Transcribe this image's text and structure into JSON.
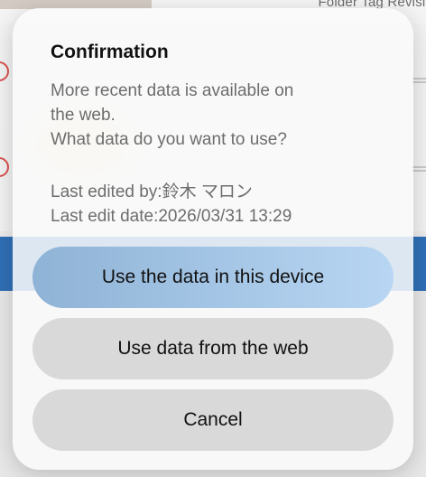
{
  "background": {
    "tabs_text": "Folder   Tag   Revisio"
  },
  "dialog": {
    "title": "Confirmation",
    "message_lines": [
      "More recent data is available on",
      "the web.",
      "What data do you want to use?"
    ],
    "last_edited_by": "Last edited by:鈴木 マロン",
    "last_edit_date": "Last edit date:2026/03/31 13:29",
    "buttons": {
      "use_device": "Use the data in this device",
      "use_web": "Use data from the web",
      "cancel": "Cancel"
    }
  },
  "colors": {
    "primary_button": "#b8d6f3",
    "secondary_button": "#d9d9d9",
    "background_blue": "#2f6fb5"
  }
}
